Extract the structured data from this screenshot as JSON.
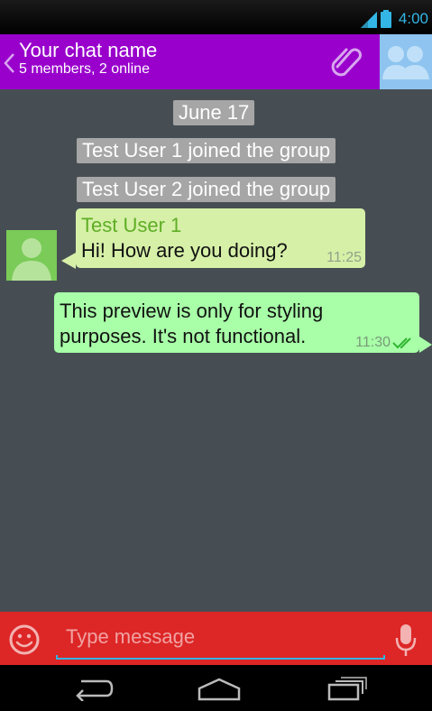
{
  "status_bar": {
    "time": "4:00"
  },
  "header": {
    "title": "Your chat name",
    "subtitle": "5 members, 2 online"
  },
  "chat": {
    "date_label": "June 17",
    "system_messages": [
      "Test User 1 joined the group",
      "Test User 2 joined the group"
    ],
    "incoming": {
      "sender": "Test User 1",
      "text": "Hi! How are you doing?",
      "time": "11:25"
    },
    "outgoing": {
      "line1": "This preview is only for styling",
      "line2": "purposes. It's not functional.",
      "time": "11:30"
    }
  },
  "composer": {
    "placeholder": "Type message"
  },
  "colors": {
    "app_bar": "#9900cc",
    "chat_background": "#474e53",
    "input_bar": "#dd2626",
    "incoming_bubble": "#d6f0a8",
    "outgoing_bubble": "#a8ffa8",
    "sender_name": "#5fae25",
    "accent": "#33b5e5"
  },
  "icons": {
    "back": "chevron-left-icon",
    "attach": "paperclip-icon",
    "group_avatar": "group-icon",
    "user_avatar": "person-icon",
    "read_receipt": "double-check-icon",
    "emoji": "smiley-icon",
    "mic": "microphone-icon",
    "nav": [
      "back-icon",
      "home-icon",
      "recent-apps-icon"
    ]
  }
}
